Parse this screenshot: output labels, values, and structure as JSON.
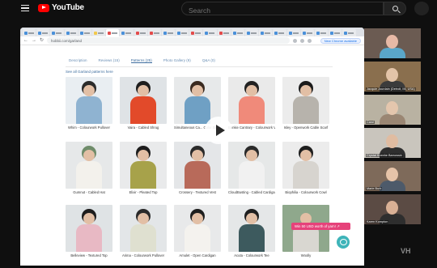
{
  "youtube": {
    "logo_text": "YouTube",
    "search_placeholder": "Search"
  },
  "browser": {
    "url": "hobbii.com/garland",
    "chrome_button": "New Chrome available",
    "tab_favicon_colors": [
      "#4a90d9",
      "#4a90d9",
      "#4a90d9",
      "#4a90d9",
      "#4a90d9",
      "#f2c94c",
      "#e34b4b",
      "#4a90d9",
      "#e34b4b",
      "#e34b4b",
      "#4a90d9",
      "#4a90d9",
      "#e34b4b",
      "#4a90d9",
      "#e34b4b",
      "#4a90d9",
      "#4a90d9",
      "#4a90d9",
      "#4a90d9",
      "#4a90d9",
      "#4a90d9",
      "#4a90d9",
      "#4a90d9",
      "#4a90d9"
    ]
  },
  "page": {
    "tabs": [
      {
        "label": "Description",
        "active": false
      },
      {
        "label": "Reviews (15)",
        "active": false
      },
      {
        "label": "Patterns (25)",
        "active": true
      },
      {
        "label": "Photo Gallery (9)",
        "active": false
      },
      {
        "label": "Q&A (0)",
        "active": false
      }
    ],
    "see_all_link": "See all Garland patterns here",
    "patterns": [
      {
        "name": "Whim - Colourwork Pullover",
        "bg": "#e9eef2",
        "top": "#8fb3d1",
        "hair": "#2b2b2b"
      },
      {
        "name": "Vaira - Cabled Shrug",
        "bg": "#dfe3e6",
        "top": "#e24a2a",
        "hair": "#1e1e1e"
      },
      {
        "name": "Simultaneous Ca... Color Block Blo...",
        "bg": "#e7e9ea",
        "top": "#6fa0c4",
        "hair": "#3a2a20"
      },
      {
        "name": "Bankie Cantrary - Colourwork Vest",
        "bg": "#eaeaea",
        "top": "#f08a7a",
        "hair": "#222222"
      },
      {
        "name": "Isley - Openwork Cable Scarf",
        "bg": "#ececec",
        "top": "#b7b3ac",
        "hair": "#1b1b1b"
      },
      {
        "name": "Gumnut - Cabled Hat",
        "bg": "#e6e8e9",
        "top": "#f3f1ec",
        "hair": "#6f8c6a"
      },
      {
        "name": "Elixir - Pleated Top",
        "bg": "#e9eaeb",
        "top": "#a7a24a",
        "hair": "#1d1d1d"
      },
      {
        "name": "Crossery - Textured Vest",
        "bg": "#e4e6e8",
        "top": "#b86a5a",
        "hair": "#2a2a2a"
      },
      {
        "name": "CloudBusting - Cabled Cardigan",
        "bg": "#e6e8e8",
        "top": "#f1f1f1",
        "hair": "#2a2a2a"
      },
      {
        "name": "Biophilia - Colourwork Cowl",
        "bg": "#ececec",
        "top": "#d7d4cf",
        "hair": "#1f1f1f"
      },
      {
        "name": "Belleview - Textured Top",
        "bg": "#dfe3e5",
        "top": "#e8b9c4",
        "hair": "#1d1d1d"
      },
      {
        "name": "Arima - Colourwork Pullover",
        "bg": "#e3e6e8",
        "top": "#dfe0d0",
        "hair": "#2a2a2a"
      },
      {
        "name": "Amulet - Open Cardigan",
        "bg": "#e8e9ea",
        "top": "#f4f2ee",
        "hair": "#1e1e1e"
      },
      {
        "name": "Acuta - Colourwork Tee",
        "bg": "#e5e7e8",
        "top": "#3d5a5e",
        "hair": "#1f1f1f"
      },
      {
        "name": "Woolly",
        "bg": "#8fa88c",
        "top": "#d9d7d1",
        "hair": "#8fa88c"
      }
    ],
    "promo_text": "Win 50 USD worth of yarn! ↗"
  },
  "participants": [
    {
      "name": "",
      "bg": "#6b5b52",
      "face": "#e7b9a6",
      "torso": "#5aa6c9"
    },
    {
      "name": "Jacquie Jourdain (Detroit, MI, USA)",
      "bg": "#8a6f4e",
      "face": "#e3c4a8",
      "torso": "#3b3b3b"
    },
    {
      "name": "Carol",
      "bg": "#b9b2a2",
      "face": "#e4c6ad",
      "torso": "#9a8673"
    },
    {
      "name": "Crystal Kneebe Barrowski",
      "bg": "#c9c5bd",
      "face": "#e0bca1",
      "torso": "#2f2f2f"
    },
    {
      "name": "Marie Burk",
      "bg": "#7e6a5a",
      "face": "#e6c3a8",
      "torso": "#4d5a6a"
    },
    {
      "name": "Karen Kompton",
      "bg": "#5b4b44",
      "face": "#d9b095",
      "torso": "#2e2e2e"
    }
  ],
  "watermark": "VH"
}
